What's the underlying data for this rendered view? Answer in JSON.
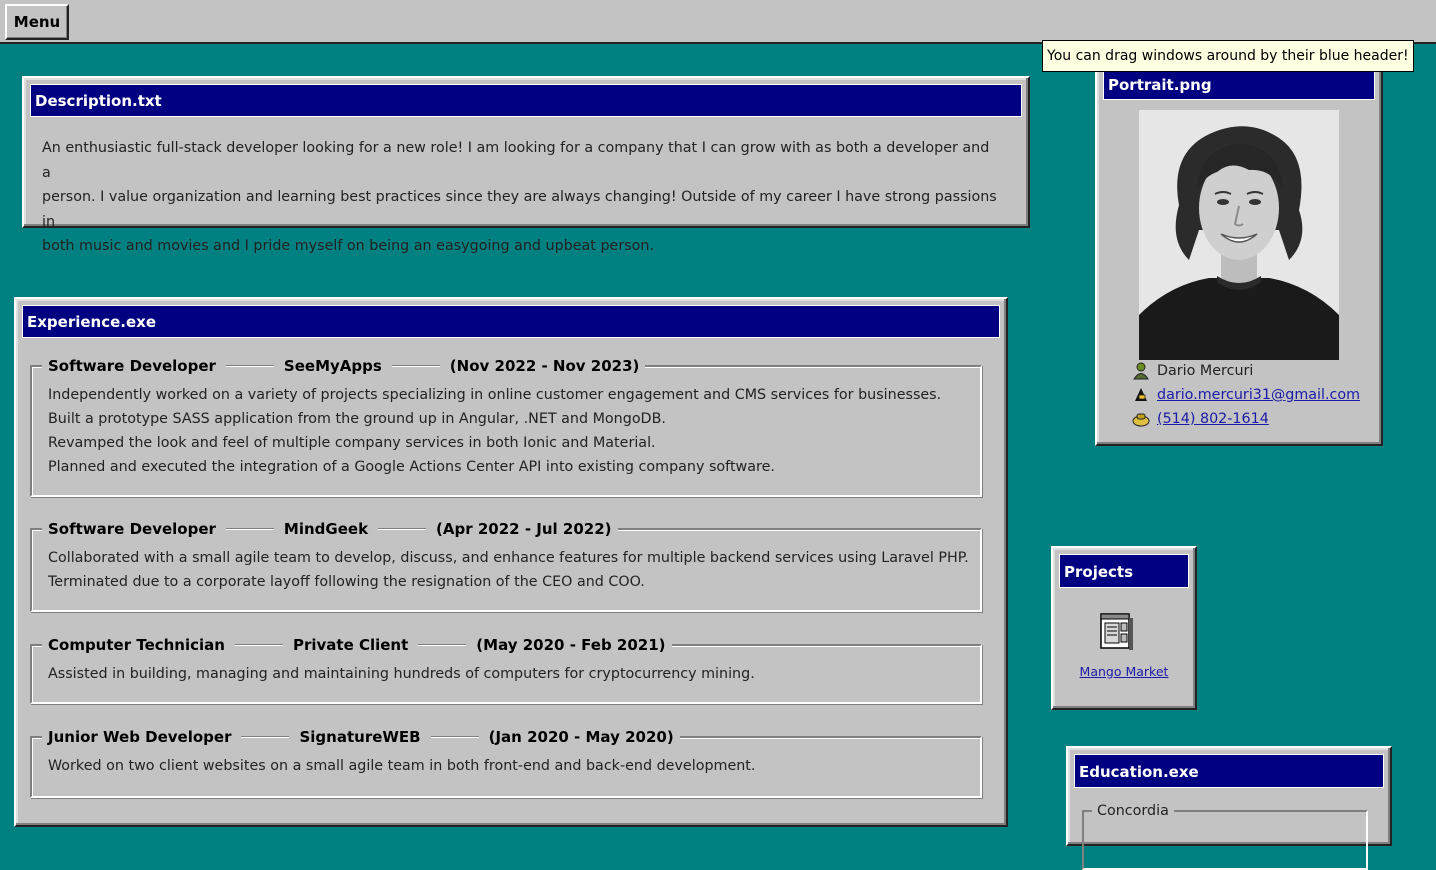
{
  "taskbar": {
    "menu_label": "Menu"
  },
  "tooltip": "You can drag windows around by their blue header!",
  "description": {
    "title": "Description.txt",
    "lines": [
      "An enthusiastic full-stack developer looking for a new role! I am looking for a company that I can grow with as both a developer and a",
      "person. I value organization and learning best practices since they are always changing! Outside of my career I have strong passions in",
      "both music and movies and I pride myself on being an easygoing and upbeat person."
    ]
  },
  "experience": {
    "title": "Experience.exe",
    "jobs": [
      {
        "role": "Software Developer",
        "company": "SeeMyApps",
        "dates": "(Nov 2022 - Nov 2023)",
        "lines": [
          "Independently worked on a variety of projects specializing in online customer engagement and CMS services for businesses.",
          "Built a prototype SASS application from the ground up in Angular, .NET and MongoDB.",
          "Revamped the look and feel of multiple company services in both Ionic and Material.",
          "Planned and executed the integration of a Google Actions Center API into existing company software."
        ]
      },
      {
        "role": "Software Developer",
        "company": "MindGeek",
        "dates": "(Apr 2022 - Jul 2022)",
        "lines": [
          "Collaborated with a small agile team to develop, discuss, and enhance features for multiple backend services using Laravel PHP.",
          "Terminated due to a corporate layoff following the resignation of the CEO and COO."
        ]
      },
      {
        "role": "Computer Technician",
        "company": "Private Client",
        "dates": "(May 2020 - Feb 2021)",
        "lines": [
          "Assisted in building, managing and maintaining hundreds of computers for cryptocurrency mining."
        ]
      },
      {
        "role": "Junior Web Developer",
        "company": "SignatureWEB",
        "dates": "(Jan 2020 - May 2020)",
        "lines": [
          "Worked on two client websites on a small agile team in both front-end and back-end development."
        ]
      }
    ]
  },
  "portrait": {
    "title": "Portrait.png",
    "name": "Dario Mercuri",
    "email": "dario.mercuri31@gmail.com",
    "phone": "(514) 802-1614",
    "icons": {
      "name": "person-icon",
      "email": "mail-icon",
      "phone": "phone-icon"
    }
  },
  "projects": {
    "title": "Projects",
    "items": [
      {
        "label": "Mango Market",
        "icon": "program-window-icon"
      }
    ]
  },
  "education": {
    "title": "Education.exe",
    "schools": [
      {
        "name": "Concordia"
      }
    ]
  },
  "colors": {
    "desktop": "#008080",
    "titlebar": "#000080",
    "window": "#c3c3c3",
    "tooltip": "#ffffe1",
    "link": "#1a1aa8"
  }
}
